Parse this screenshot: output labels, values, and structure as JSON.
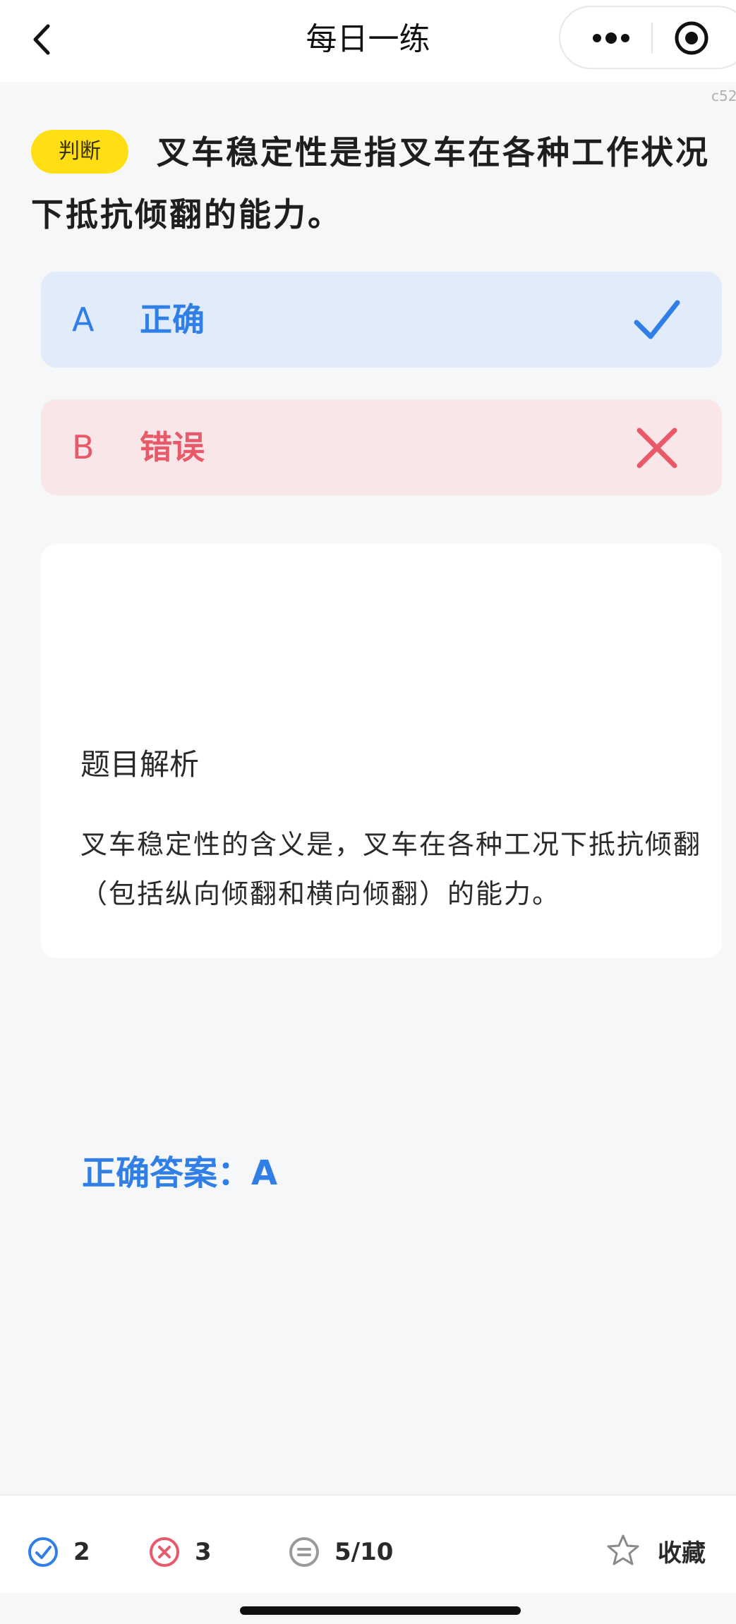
{
  "nav": {
    "title": "每日一练",
    "version_tag": "c52"
  },
  "question": {
    "type_badge": "判断",
    "text": "叉车稳定性是指叉车在各种工作状况下抵抗倾翻的能力。"
  },
  "options": [
    {
      "letter": "A",
      "text": "正确",
      "status": "correct",
      "color": "#2f7fe7"
    },
    {
      "letter": "B",
      "text": "错误",
      "status": "wrong",
      "color": "#e85a6a"
    }
  ],
  "answer": {
    "correct_answer": "正确答案：A",
    "analysis_title": "题目解析",
    "analysis_text": "叉车稳定性的含义是，叉车在各种工况下抵抗倾翻（包括纵向倾翻和横向倾翻）的能力。"
  },
  "bottom_bar": {
    "correct_count": "2",
    "wrong_count": "3",
    "progress": "5/10",
    "favorite_label": "收藏"
  },
  "colors": {
    "accent_blue": "#2f7fe7",
    "error_red": "#e85a6a",
    "badge_yellow": "#ffdf14"
  },
  "icons": {
    "back": "chevron-left-icon",
    "more": "more-dots-icon",
    "target": "target-icon",
    "correct_mark": "check-icon",
    "wrong_mark": "cross-icon",
    "stat_correct": "check-circle-icon",
    "stat_wrong": "x-circle-icon",
    "stat_progress": "list-circle-icon",
    "favorite": "star-icon"
  }
}
